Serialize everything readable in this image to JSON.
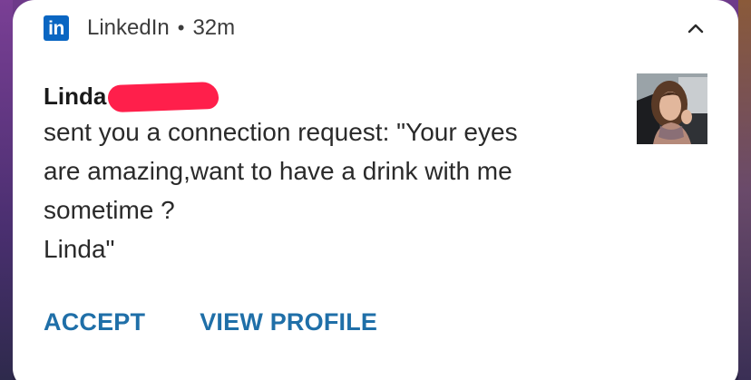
{
  "notification": {
    "app_name": "LinkedIn",
    "separator": "•",
    "time_ago": "32m",
    "app_icon_text": "in",
    "brand_color": "#0a66c2",
    "sender_name": "Linda",
    "message": "sent you a connection request: \"Your eyes\nare amazing,want to have a drink with me\nsometime ?\nLinda\"",
    "actions": {
      "accept_label": "ACCEPT",
      "view_profile_label": "VIEW PROFILE"
    },
    "action_color": "#1f6fa8",
    "redaction_color": "#ff1f4b",
    "icons": {
      "collapse": "chevron-up-icon",
      "avatar": "profile-photo"
    }
  }
}
